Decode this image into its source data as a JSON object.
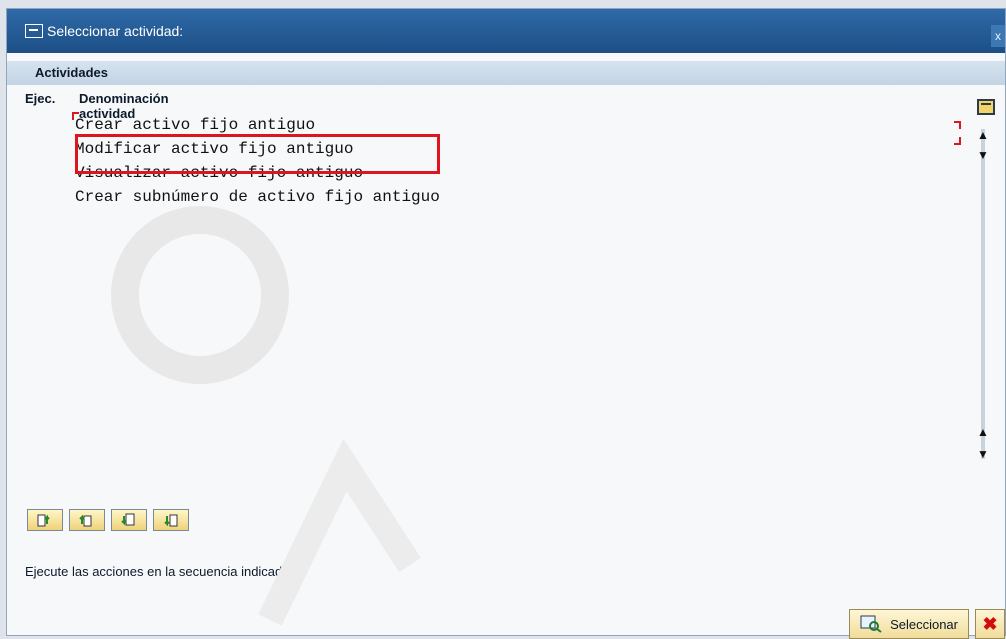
{
  "window": {
    "title": "Seleccionar actividad:",
    "close_label": "x"
  },
  "section": {
    "header": "Actividades"
  },
  "columns": {
    "exec": "Ejec.",
    "name": "Denominación actividad"
  },
  "activities": [
    {
      "label": "Crear activo fijo antiguo"
    },
    {
      "label": "Modificar activo fijo antiguo"
    },
    {
      "label": "Visualizar activo fijo antiguo"
    },
    {
      "label": "Crear subnúmero de activo fijo antiguo"
    }
  ],
  "highlighted_index": 1,
  "toolbar": {
    "buttons": [
      {
        "icon": "move-up-icon"
      },
      {
        "icon": "move-top-icon"
      },
      {
        "icon": "move-down-icon"
      },
      {
        "icon": "move-bottom-icon"
      }
    ]
  },
  "status": {
    "text": "Ejecute las acciones en la secuencia indicada"
  },
  "actions": {
    "select_label": "Seleccionar",
    "cancel_icon": "cancel-icon"
  },
  "colors": {
    "titlebar": "#2f6aa8",
    "highlight": "#e0141e",
    "button_bg": "#efd27a"
  }
}
